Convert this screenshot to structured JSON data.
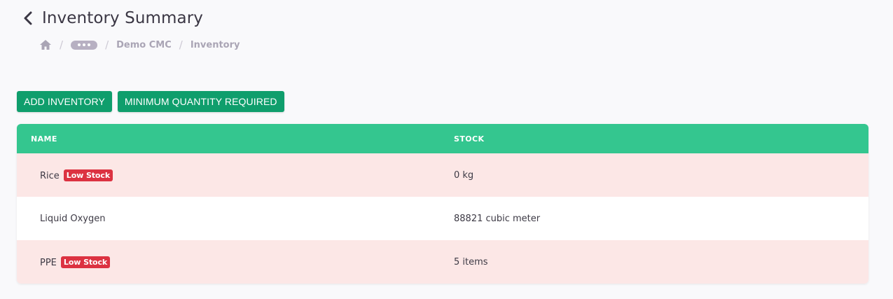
{
  "page": {
    "title": "Inventory Summary"
  },
  "breadcrumb": {
    "home_icon": "home-icon",
    "collapsed_icon": "ellipsis-icon",
    "items": [
      "Demo CMC",
      "Inventory"
    ]
  },
  "actions": {
    "add_label": "ADD INVENTORY",
    "min_qty_label": "MINIMUM QUANTITY REQUIRED"
  },
  "table": {
    "columns": [
      "NAME",
      "STOCK"
    ],
    "rows": [
      {
        "name": "Rice",
        "badge": "Low Stock",
        "stock": "0 kg"
      },
      {
        "name": "Liquid Oxygen",
        "badge": "",
        "stock": "88821 cubic meter"
      },
      {
        "name": "PPE",
        "badge": "Low Stock",
        "stock": "5 items"
      }
    ]
  },
  "colors": {
    "primary_button": "#0f9e6c",
    "table_header": "#34c68f",
    "low_stock_row": "#fce7e6",
    "badge": "#dc3241"
  }
}
